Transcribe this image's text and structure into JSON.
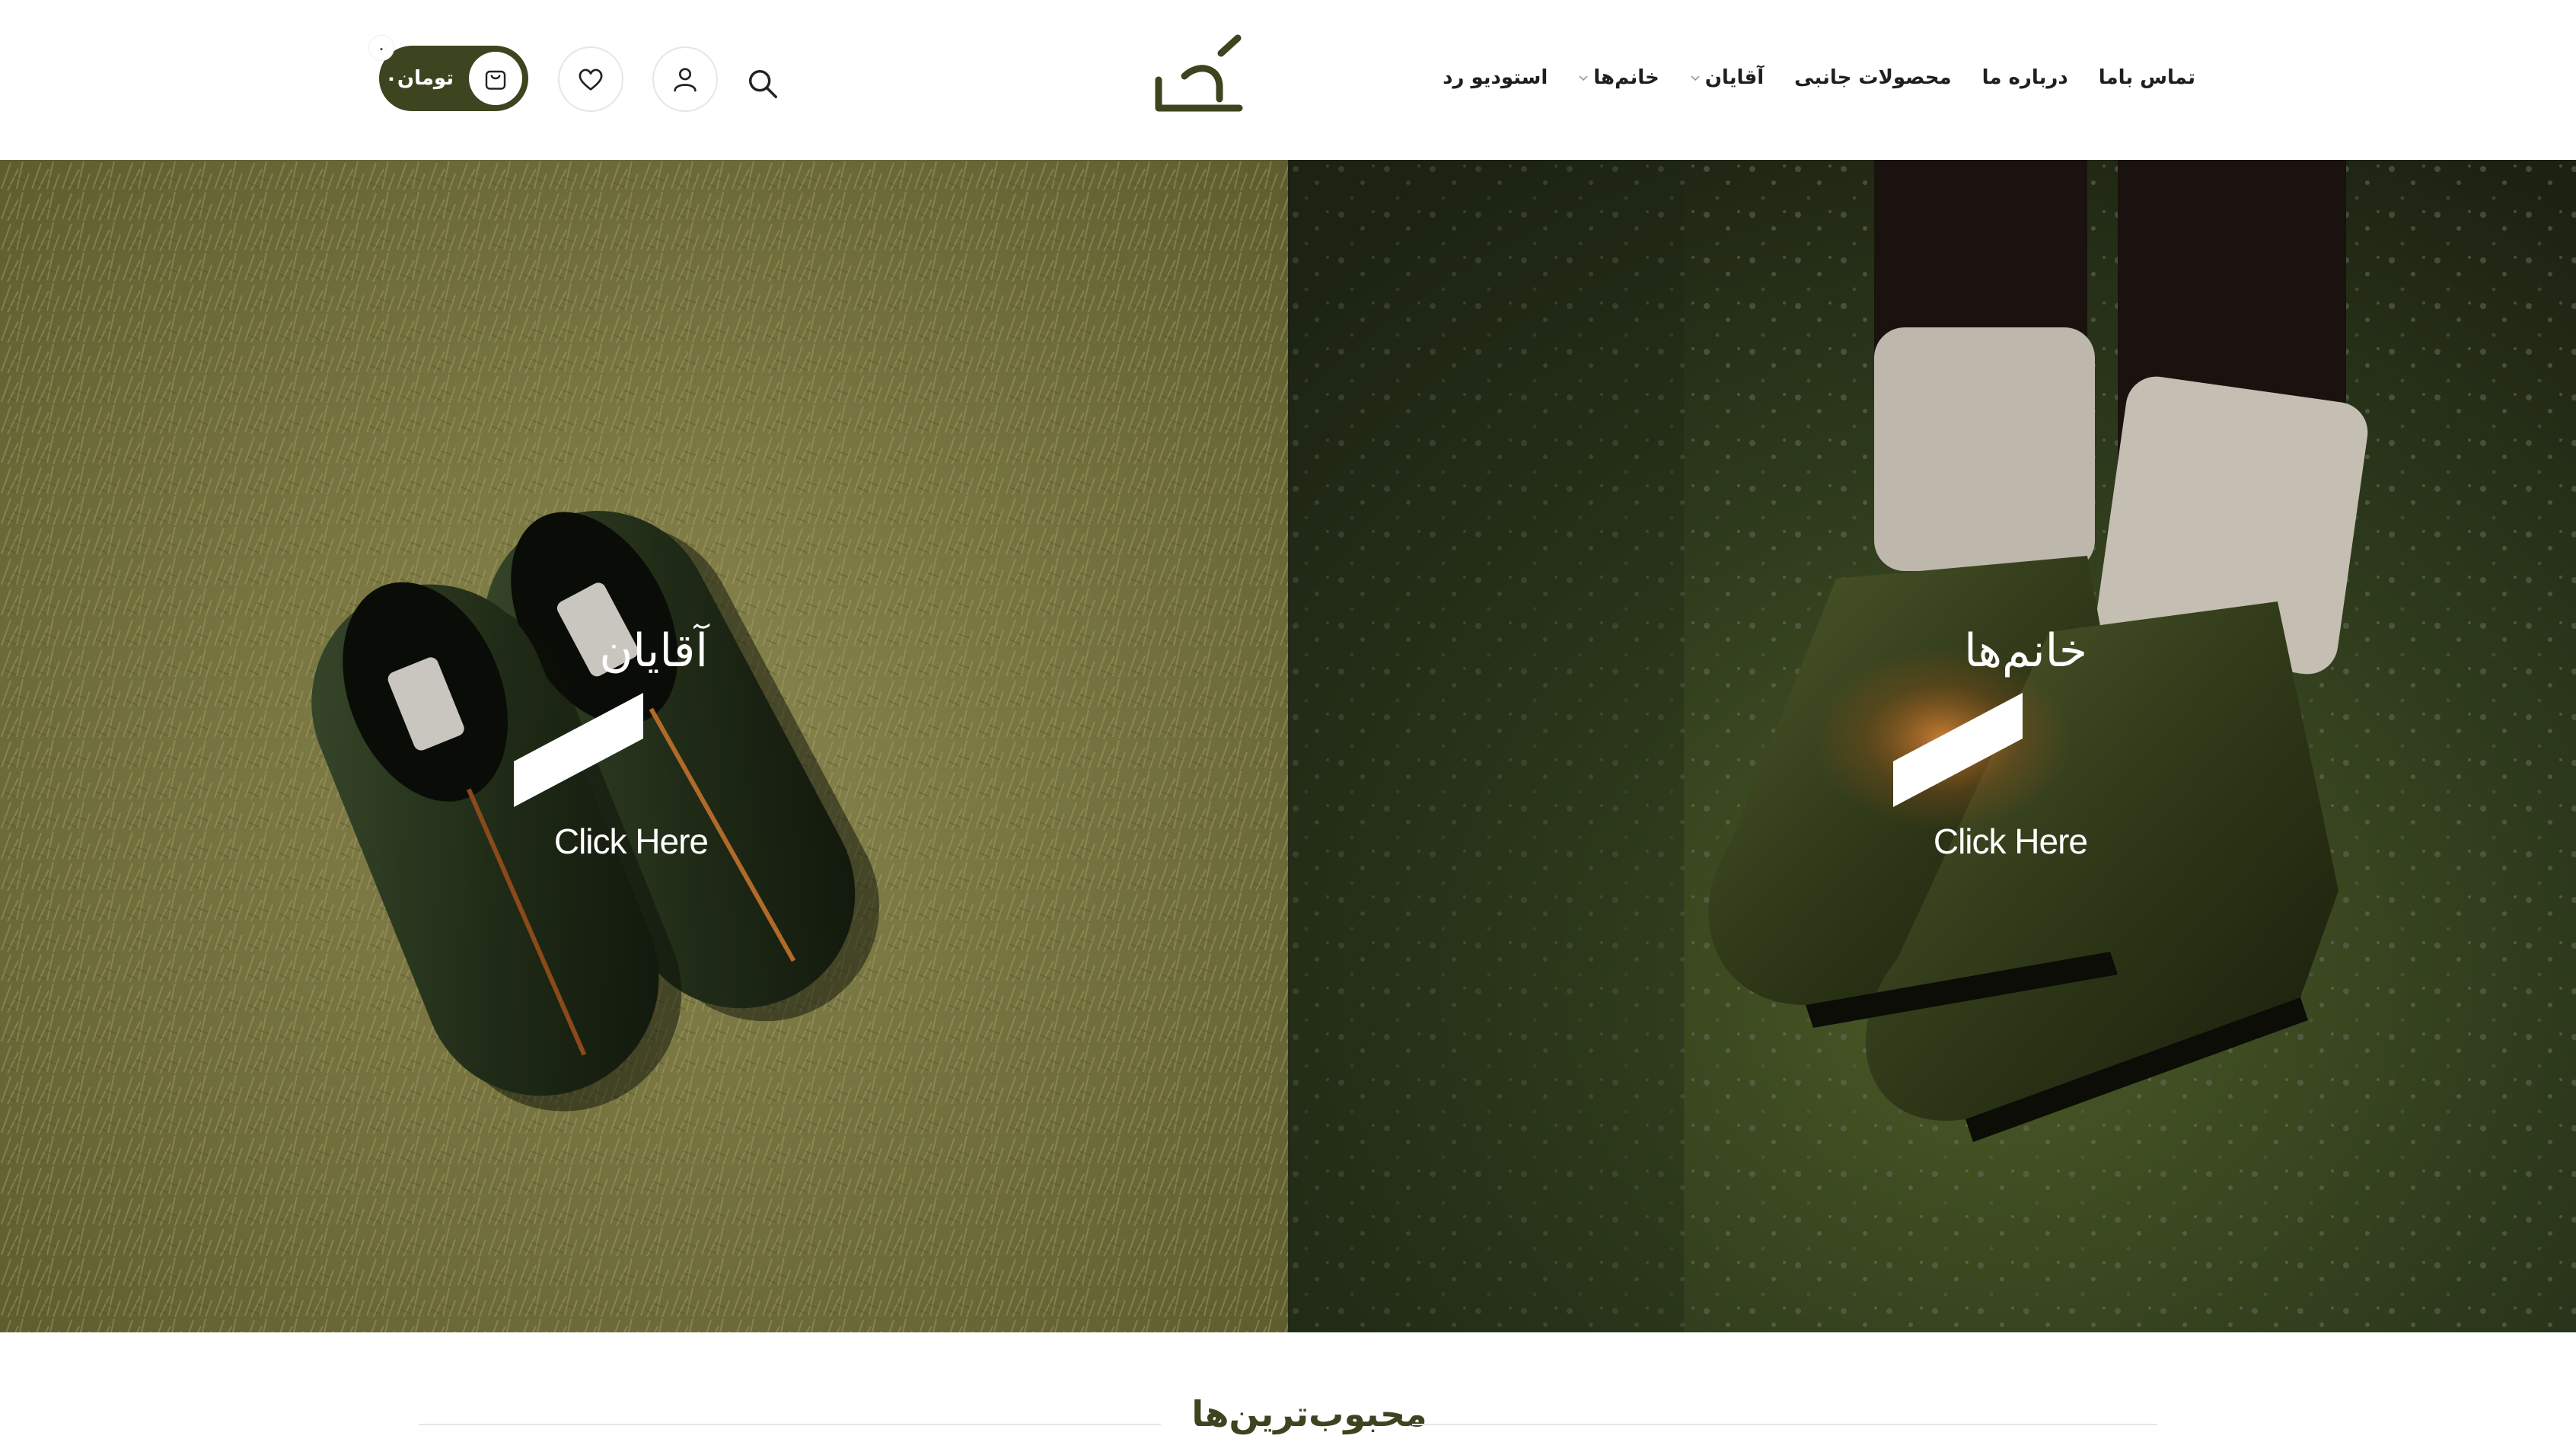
{
  "header": {
    "nav": [
      {
        "label": "استودیو رد",
        "has_dropdown": false
      },
      {
        "label": "خانم‌ها",
        "has_dropdown": true
      },
      {
        "label": "آقایان",
        "has_dropdown": true
      },
      {
        "label": "محصولات جانبی",
        "has_dropdown": false
      },
      {
        "label": "درباره ما",
        "has_dropdown": false
      },
      {
        "label": "تماس باما",
        "has_dropdown": false
      }
    ],
    "cart": {
      "label": "تومان",
      "amount": "۰",
      "badge": "۰"
    }
  },
  "hero": {
    "men": {
      "title": "آقایان",
      "link": "Click Here"
    },
    "women": {
      "title": "خانم‌ها",
      "link": "Click Here"
    }
  },
  "section": {
    "title": "محبوب‌ترین‌ها"
  },
  "colors": {
    "brand": "#3d4420",
    "text": "#1f1f1f",
    "white": "#ffffff"
  }
}
